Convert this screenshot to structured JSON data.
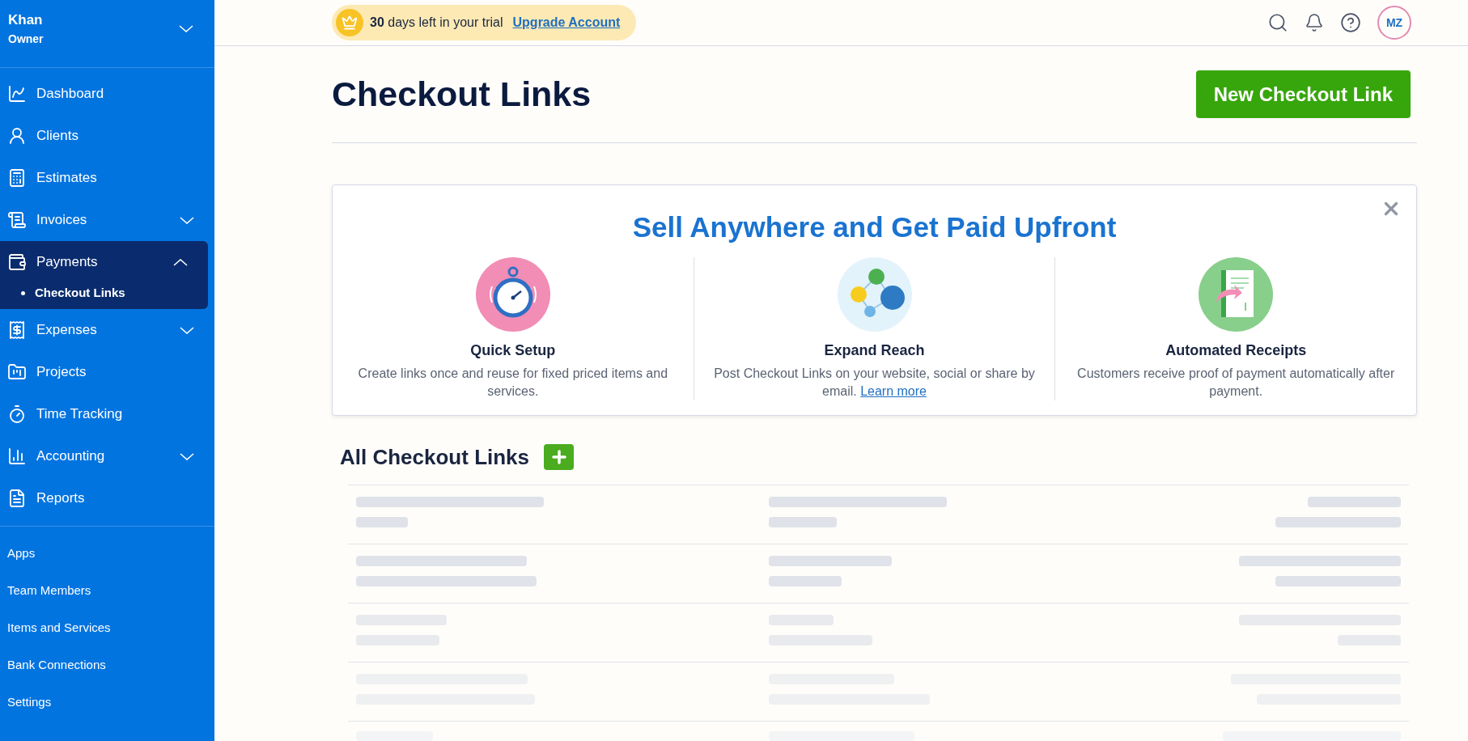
{
  "account": {
    "name": "Khan",
    "role": "Owner",
    "expanded": false
  },
  "nav": [
    {
      "label": "Dashboard",
      "selected": false
    },
    {
      "label": "Clients",
      "selected": false
    },
    {
      "label": "Estimates",
      "selected": false
    },
    {
      "label": "Invoices",
      "selected": false,
      "expanded": false
    },
    {
      "label": "Payments",
      "selected": true,
      "expanded": true,
      "children": [
        {
          "label": "Checkout Links",
          "selected": true
        }
      ]
    },
    {
      "label": "Expenses",
      "selected": false,
      "expanded": false
    },
    {
      "label": "Projects",
      "selected": false
    },
    {
      "label": "Time Tracking",
      "selected": false
    },
    {
      "label": "Accounting",
      "selected": false,
      "expanded": false
    },
    {
      "label": "Reports",
      "selected": false
    }
  ],
  "secondary_nav": [
    "Apps",
    "Team Members",
    "Items and Services",
    "Bank Connections",
    "Settings"
  ],
  "trial": {
    "days": "30",
    "text": "days left in your trial",
    "link": "Upgrade Account"
  },
  "avatar": "MZ",
  "page": {
    "title": "Checkout Links",
    "primary_button": "New Checkout Link"
  },
  "promo": {
    "title": "Sell Anywhere and Get Paid Upfront",
    "features": [
      {
        "kind": "stopwatch",
        "title": "Quick Setup",
        "text": "Create links once and reuse for fixed priced items and services."
      },
      {
        "kind": "network",
        "title": "Expand Reach",
        "text": "Post Checkout Links on your website, social or share by email.",
        "link": "Learn more"
      },
      {
        "kind": "receipt",
        "title": "Automated Receipts",
        "text": "Customers receive proof of payment automatically after payment."
      }
    ]
  },
  "list": {
    "title": "All Checkout Links",
    "rows": [
      {
        "kind": "loading"
      },
      {
        "kind": "loading"
      },
      {
        "kind": "loading"
      },
      {
        "kind": "loading"
      },
      {
        "kind": "loading_cut"
      }
    ]
  }
}
